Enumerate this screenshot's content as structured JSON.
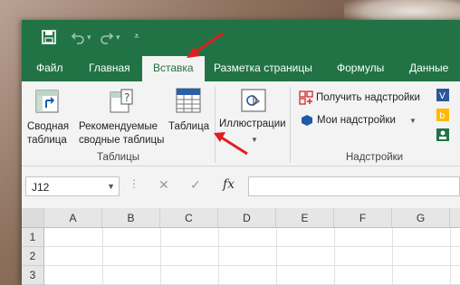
{
  "quick_access": {
    "save_icon": "save-icon",
    "undo_icon": "undo-icon",
    "redo_icon": "redo-icon",
    "customize_icon": "customize-qat-icon"
  },
  "tabs": [
    "Файл",
    "Главная",
    "Вставка",
    "Разметка страницы",
    "Формулы",
    "Данные"
  ],
  "active_tab": "Вставка",
  "ribbon": {
    "pivot_table": {
      "line1": "Сводная",
      "line2": "таблица"
    },
    "recommended_pivot": {
      "line1": "Рекомендуемые",
      "line2": "сводные таблицы"
    },
    "table": {
      "label": "Таблица"
    },
    "tables_group": "Таблицы",
    "illustrations": {
      "label": "Иллюстрации"
    },
    "get_addins": "Получить надстройки",
    "my_addins": "Мои надстройки",
    "addins_group": "Надстройки"
  },
  "formula_bar": {
    "name_box": "J12",
    "cancel": "✕",
    "enter": "✓",
    "fx": "fx",
    "value": ""
  },
  "grid": {
    "columns": [
      "A",
      "B",
      "C",
      "D",
      "E",
      "F",
      "G"
    ],
    "rows": [
      "1",
      "2",
      "3"
    ]
  },
  "colors": {
    "brand": "#217346",
    "annotation_arrow": "#e01e1e"
  }
}
